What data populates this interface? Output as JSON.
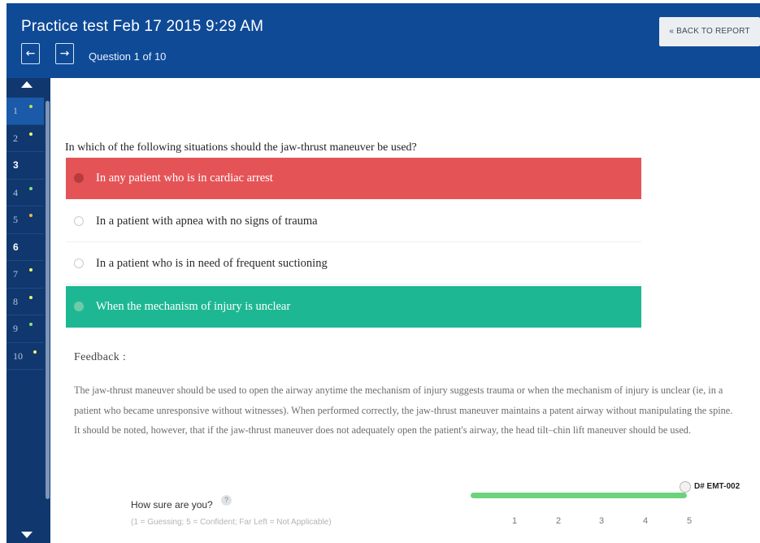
{
  "header": {
    "title": "Practice test Feb 17 2015 9:29 AM",
    "prev_icon": "←",
    "next_icon": "→",
    "question_counter": "Question 1 of 10",
    "back_label": "« BACK TO REPORT"
  },
  "sidebar": {
    "items": [
      {
        "num": "1",
        "dot_color": "#b9e35a",
        "active": true
      },
      {
        "num": "2",
        "dot_color": "#f1f56b",
        "active": false
      },
      {
        "num": "3",
        "dot_color": "",
        "active": false
      },
      {
        "num": "4",
        "dot_color": "#8ee07a",
        "active": false
      },
      {
        "num": "5",
        "dot_color": "#f5b44a",
        "active": false
      },
      {
        "num": "6",
        "dot_color": "",
        "active": false
      },
      {
        "num": "7",
        "dot_color": "#f1f56b",
        "active": false
      },
      {
        "num": "8",
        "dot_color": "#f1f56b",
        "active": false
      },
      {
        "num": "9",
        "dot_color": "#8ee07a",
        "active": false
      },
      {
        "num": "10",
        "dot_color": "#f1f56b",
        "active": false
      }
    ]
  },
  "question": {
    "text": "In which of the following situations should the jaw-thrust maneuver be used?",
    "answers": [
      {
        "label": "In any patient who is in cardiac arrest",
        "state": "wrong"
      },
      {
        "label": "In a patient with apnea with no signs of trauma",
        "state": "plain"
      },
      {
        "label": "In a patient who is in need of frequent suctioning",
        "state": "plain"
      },
      {
        "label": "When the mechanism of injury is unclear",
        "state": "correct"
      }
    ]
  },
  "feedback": {
    "title": "Feedback :",
    "text": "The jaw-thrust maneuver should be used to open the airway anytime the mechanism of injury suggests trauma or when the mechanism of injury is unclear (ie, in a patient who became unresponsive without witnesses). When performed correctly, the jaw-thrust maneuver maintains a patent airway without manipulating the spine. It should be noted, however, that if the jaw-thrust maneuver does not adequately open the patient's airway, the head tilt–chin lift maneuver should be used."
  },
  "confidence": {
    "prompt": "How sure are you?",
    "help_icon": "?",
    "hint": "(1 = Guessing; 5 = Confident; Far Left = Not Applicable)",
    "scale": [
      "1",
      "2",
      "3",
      "4",
      "5"
    ],
    "selected": "5",
    "question_id": "D# EMT-002"
  },
  "colors": {
    "header_bg": "#0f4a97",
    "sidebar_bg": "#10386e",
    "wrong": "#e45457",
    "correct": "#1db893",
    "slider": "#6dd27c"
  }
}
